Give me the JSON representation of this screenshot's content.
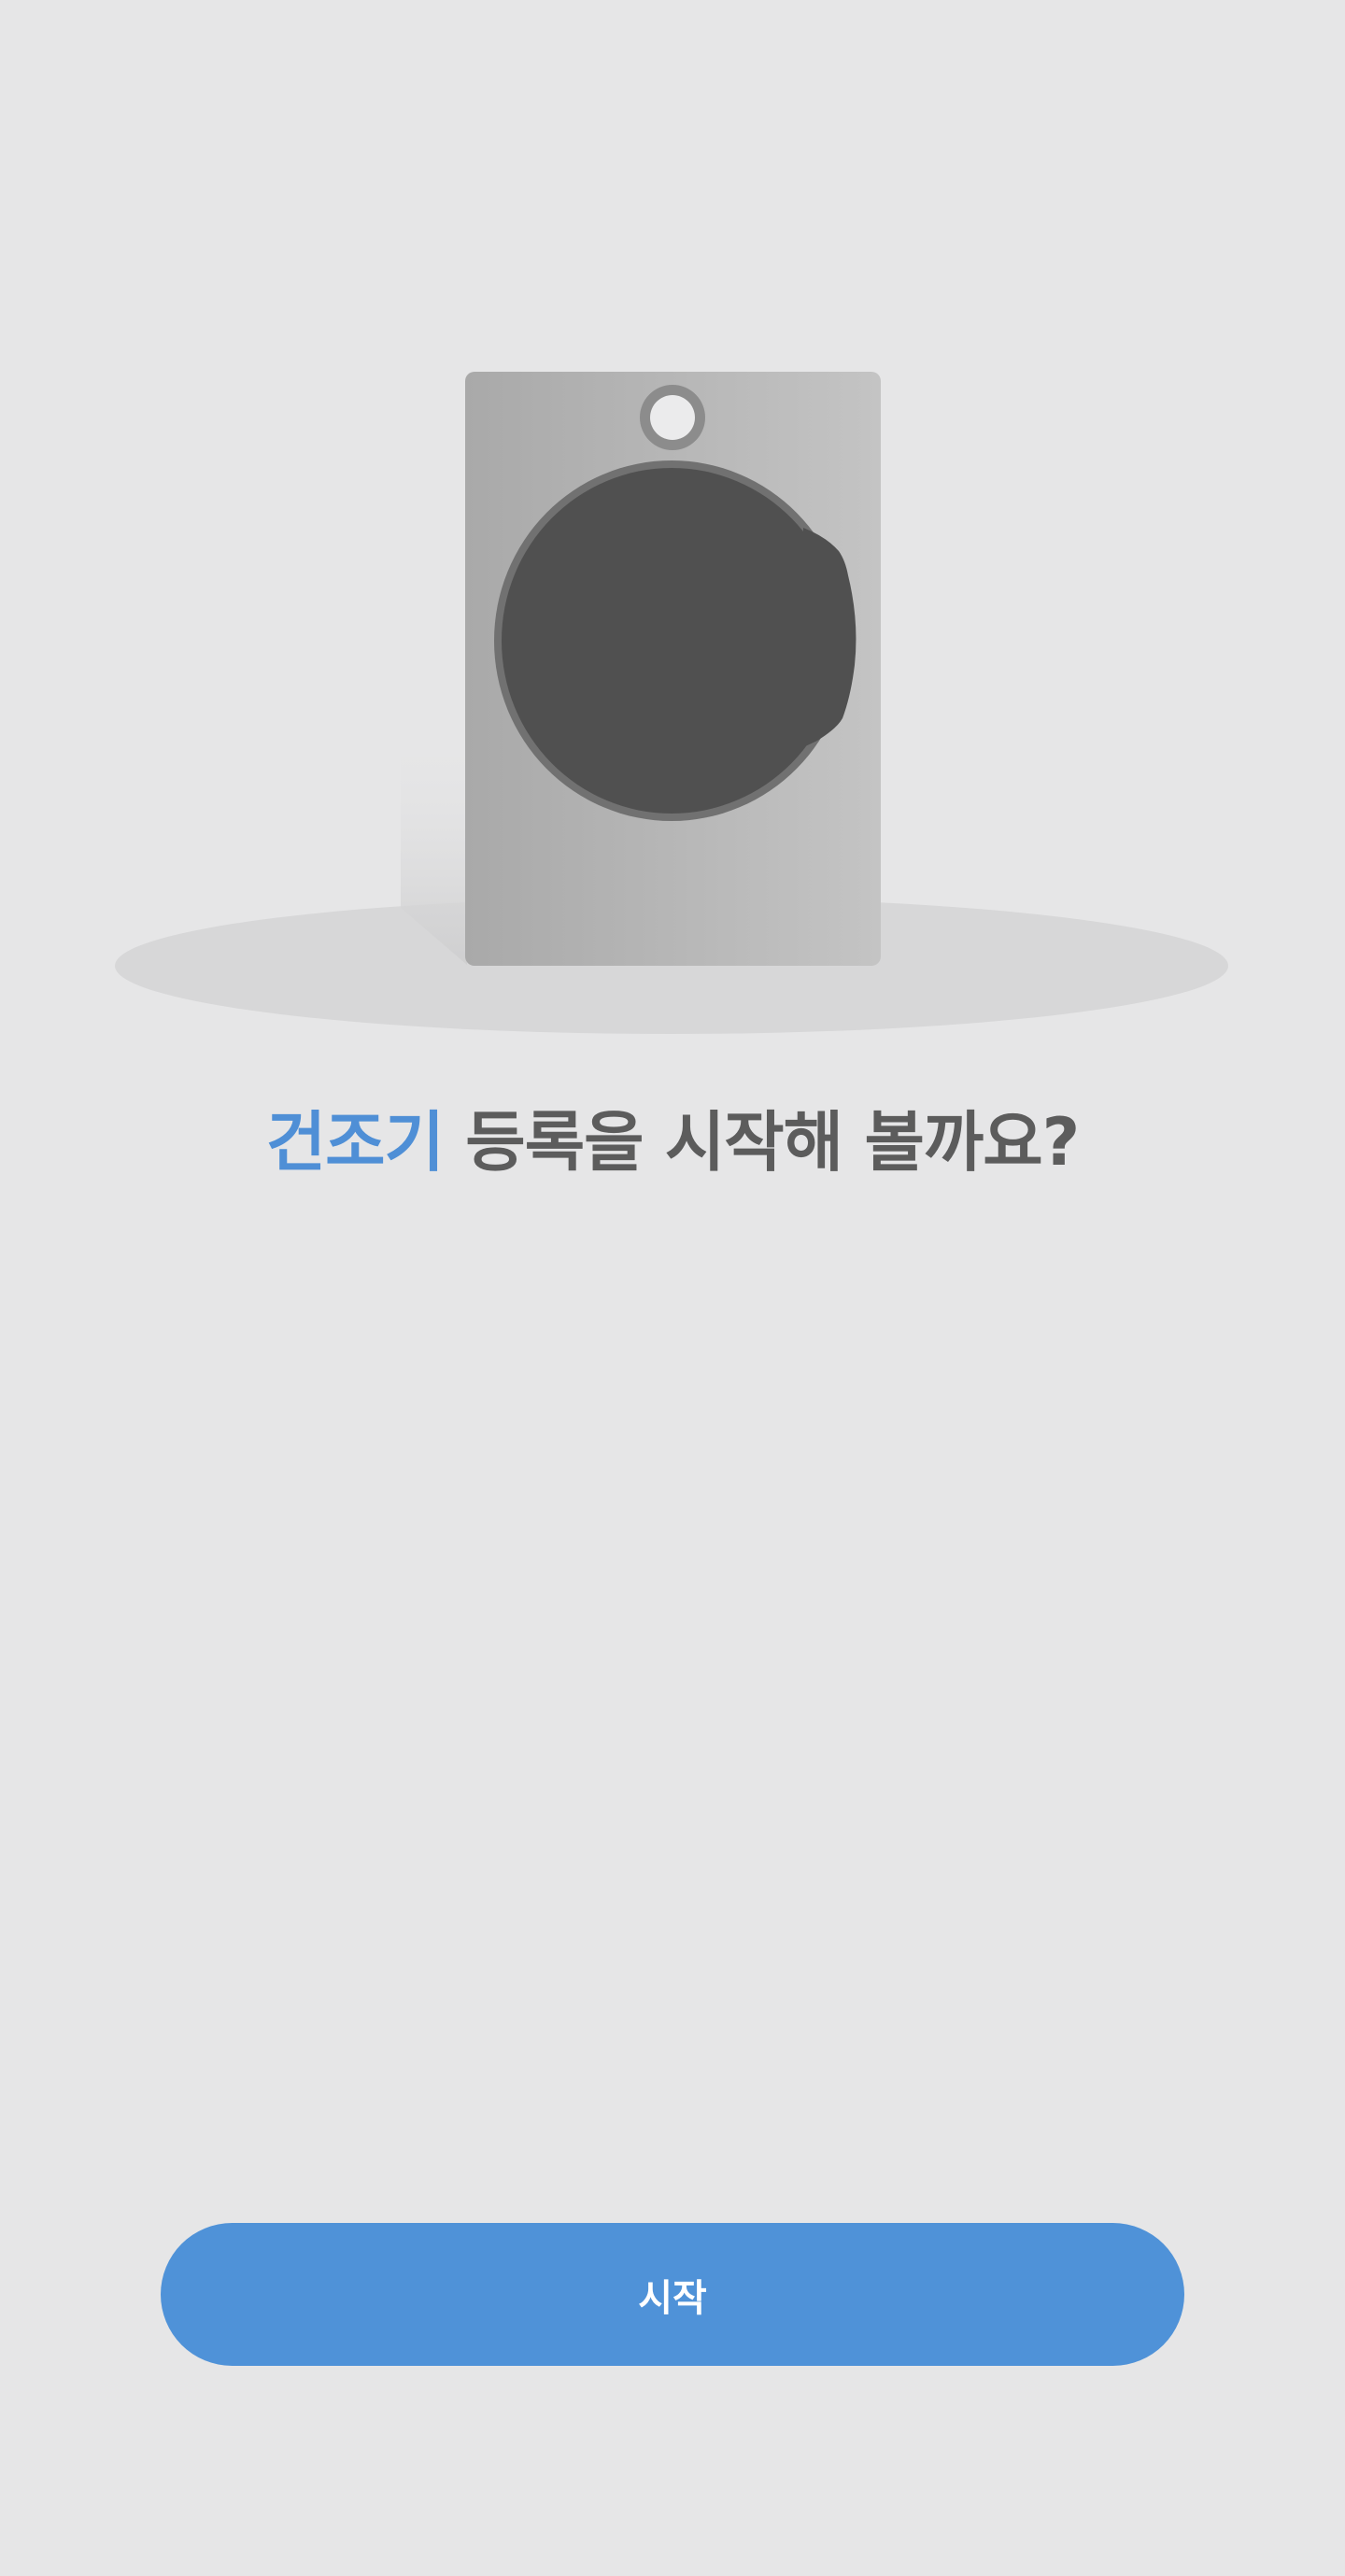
{
  "title": {
    "highlight": "건조기",
    "rest": " 등록을 시작해 볼까요?",
    "highlight_color": "#4f8fd6",
    "text_color": "#5c5c5c"
  },
  "illustration": {
    "icon": "dryer-illustration"
  },
  "start_button": {
    "label": "시작",
    "color": "#4f92d8"
  },
  "colors": {
    "background": "#e6e6e7"
  }
}
